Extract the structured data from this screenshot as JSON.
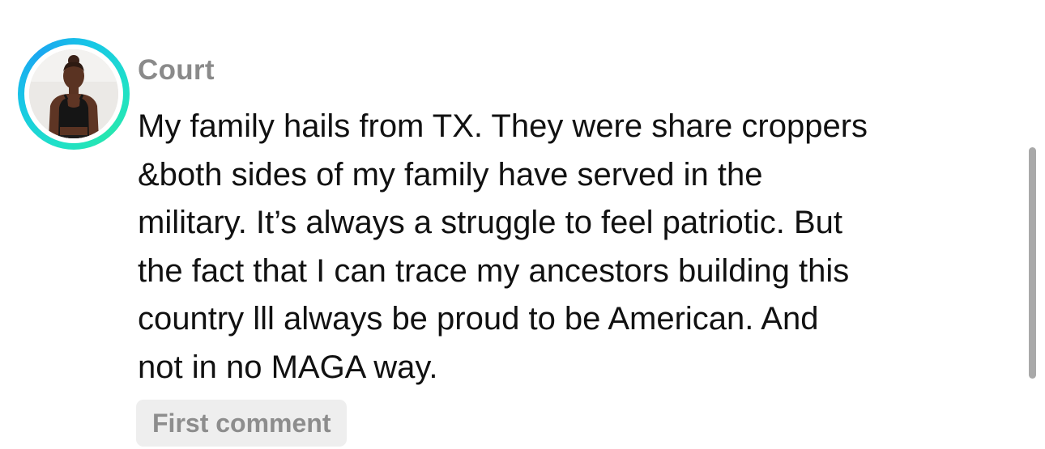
{
  "comment": {
    "author": "Court",
    "lines": [
      "My family hails from TX. They were share croppers",
      "&both sides of my family have served in the",
      "military. It’s always a struggle to feel patriotic. But",
      "the fact that I can trace my ancestors building this",
      "country lll always be proud to be American. And",
      "not in no MAGA way."
    ],
    "badge": "First comment"
  },
  "icons": {
    "avatar": "profile-photo",
    "top_edge": "partially-visible-icon"
  },
  "colors": {
    "avatar_ring_start": "#1fe0c8",
    "avatar_ring_end": "#1aa7f0",
    "author": "#8a8a8a",
    "text": "#111111",
    "badge_bg": "#eeeeee",
    "badge_text": "#8d8d8d",
    "scrollbar": "#a9a9a9"
  }
}
